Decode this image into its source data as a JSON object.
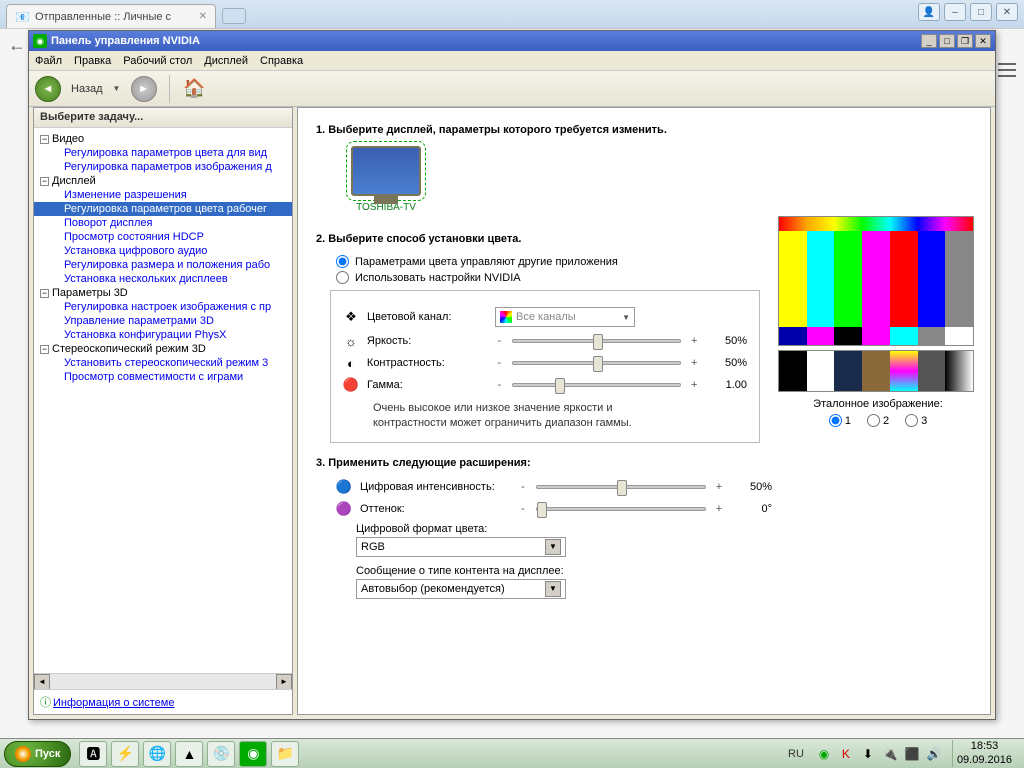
{
  "browser": {
    "tab_title": "Отправленные :: Личные с",
    "win_user": "👤",
    "win_min": "–",
    "win_max": "□",
    "win_close": "✕"
  },
  "nvidia": {
    "title": "Панель управления NVIDIA",
    "menu": {
      "file": "Файл",
      "edit": "Правка",
      "desktop": "Рабочий стол",
      "display": "Дисплей",
      "help": "Справка"
    },
    "toolbar": {
      "back": "Назад",
      "back_arrow": "◄",
      "fwd_arrow": "►",
      "home": "🏠"
    },
    "tree": {
      "header": "Выберите задачу...",
      "video": "Видео",
      "video_items": [
        "Регулировка параметров цвета для вид",
        "Регулировка параметров изображения д"
      ],
      "display": "Дисплей",
      "display_items": [
        "Изменение разрешения",
        "Регулировка параметров цвета рабочег",
        "Поворот дисплея",
        "Просмотр состояния HDCP",
        "Установка цифрового аудио",
        "Регулировка размера и положения рабо",
        "Установка нескольких дисплеев"
      ],
      "params3d": "Параметры 3D",
      "params3d_items": [
        "Регулировка настроек изображения с пр",
        "Управление параметрами 3D",
        "Установка конфигурации PhysX"
      ],
      "stereo": "Стереоскопический режим 3D",
      "stereo_items": [
        "Установить стереоскопический режим 3",
        "Просмотр совместимости с играми"
      ],
      "sysinfo": "Информация о системе"
    },
    "content": {
      "section1": "1. Выберите дисплей, параметры которого требуется изменить.",
      "display_name": "TOSHIBA-TV",
      "section2": "2. Выберите способ установки цвета.",
      "radio_other": "Параметрами цвета управляют другие приложения",
      "radio_nvidia": "Использовать настройки NVIDIA",
      "channel_label": "Цветовой канал:",
      "channel_value": "Все каналы",
      "brightness": "Яркость:",
      "brightness_val": "50%",
      "contrast": "Контрастность:",
      "contrast_val": "50%",
      "gamma": "Гамма:",
      "gamma_val": "1.00",
      "note1": "Очень высокое или низкое значение яркости и",
      "note2": "контрастности может ограничить диапазон гаммы.",
      "section3": "3. Применить следующие расширения:",
      "dig_intensity": "Цифровая интенсивность:",
      "dig_intensity_val": "50%",
      "hue": "Оттенок:",
      "hue_val": "0°",
      "color_format_label": "Цифровой формат цвета:",
      "color_format_val": "RGB",
      "content_type_label": "Сообщение о типе контента на дисплее:",
      "content_type_val": "Автовыбор (рекомендуется)",
      "ref_label": "Эталонное изображение:",
      "ref1": "1",
      "ref2": "2",
      "ref3": "3",
      "minus": "-",
      "plus": "+"
    },
    "winbtn": {
      "min": "_",
      "max": "□",
      "restore": "❐",
      "close": "✕"
    }
  },
  "taskbar": {
    "start": "Пуск",
    "lang": "RU",
    "time": "18:53",
    "date": "09.09.2016"
  }
}
